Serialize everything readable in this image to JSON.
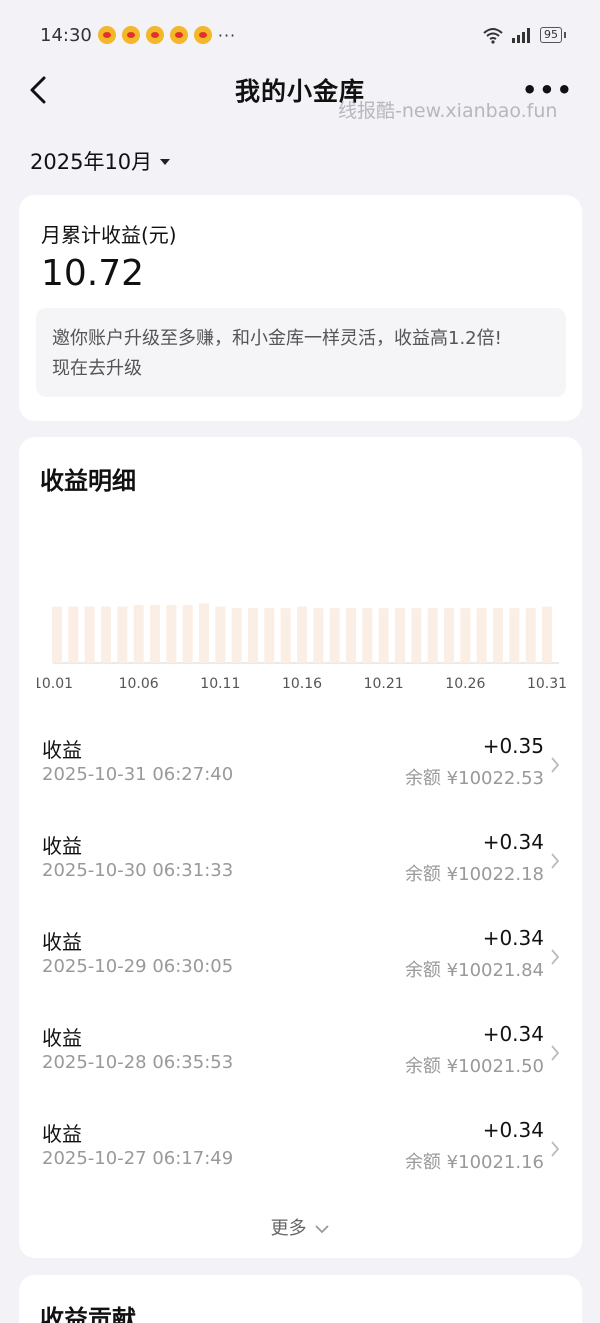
{
  "status_bar": {
    "time": "14:30",
    "more": "···",
    "battery": "95"
  },
  "nav": {
    "title": "我的小金库",
    "more": "•••"
  },
  "watermark": "线报酷-new.xianbao.fun",
  "month_selector": "2025年10月",
  "summary": {
    "label": "月累计收益(元)",
    "value": "10.72",
    "promo_line1": "邀你账户升级至多赚，和小金库一样灵活，收益高1.2倍!",
    "promo_line2": "现在去升级"
  },
  "detail": {
    "title": "收益明细",
    "records": [
      {
        "type": "收益",
        "time": "2025-10-31 06:27:40",
        "amount": "+0.35",
        "balance": "余额 ¥10022.53"
      },
      {
        "type": "收益",
        "time": "2025-10-30 06:31:33",
        "amount": "+0.34",
        "balance": "余额 ¥10022.18"
      },
      {
        "type": "收益",
        "time": "2025-10-29 06:30:05",
        "amount": "+0.34",
        "balance": "余额 ¥10021.84"
      },
      {
        "type": "收益",
        "time": "2025-10-28 06:35:53",
        "amount": "+0.34",
        "balance": "余额 ¥10021.50"
      },
      {
        "type": "收益",
        "time": "2025-10-27 06:17:49",
        "amount": "+0.34",
        "balance": "余额 ¥10021.16"
      }
    ],
    "more_label": "更多"
  },
  "contrib": {
    "title": "收益贡献"
  },
  "colors": {
    "bar": "#fbeee4",
    "baseline": "#e3e3e3",
    "tick_text": "#555555"
  },
  "chart_data": {
    "type": "bar",
    "categories": [
      "10.01",
      "10.02",
      "10.03",
      "10.04",
      "10.05",
      "10.06",
      "10.07",
      "10.08",
      "10.09",
      "10.10",
      "10.11",
      "10.12",
      "10.13",
      "10.14",
      "10.15",
      "10.16",
      "10.17",
      "10.18",
      "10.19",
      "10.20",
      "10.21",
      "10.22",
      "10.23",
      "10.24",
      "10.25",
      "10.26",
      "10.27",
      "10.28",
      "10.29",
      "10.30",
      "10.31"
    ],
    "tick_labels": [
      "10.01",
      "10.06",
      "10.11",
      "10.16",
      "10.21",
      "10.26",
      "10.31"
    ],
    "values": [
      0.35,
      0.35,
      0.35,
      0.35,
      0.35,
      0.36,
      0.36,
      0.36,
      0.36,
      0.37,
      0.35,
      0.34,
      0.34,
      0.34,
      0.34,
      0.35,
      0.34,
      0.34,
      0.34,
      0.34,
      0.34,
      0.34,
      0.34,
      0.34,
      0.34,
      0.34,
      0.34,
      0.34,
      0.34,
      0.34,
      0.35
    ],
    "ylim": [
      0,
      0.4
    ],
    "grid": false
  }
}
